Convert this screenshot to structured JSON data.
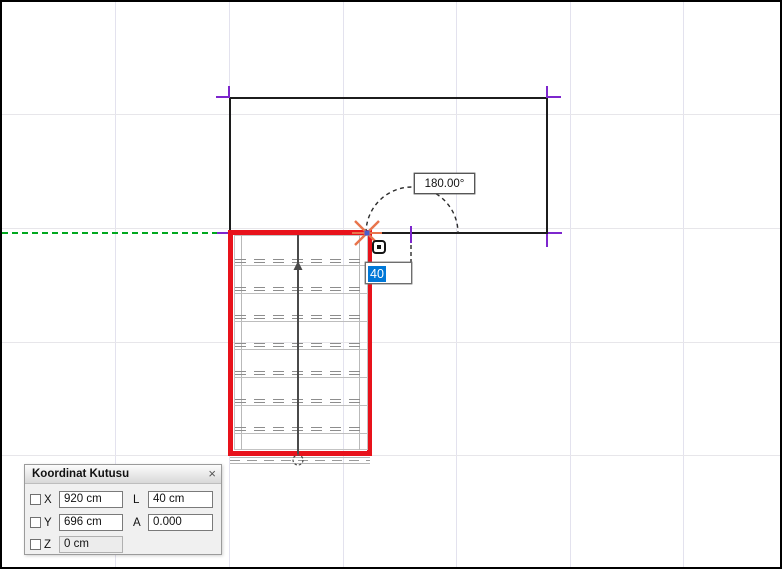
{
  "drawing": {
    "angle_readout": "180.00°",
    "length_input_value": "40",
    "colors": {
      "selection_blue": "#0078d7",
      "stair_highlight_red": "#e8121b",
      "guide_green": "#00a81e",
      "marker_purple": "#7d26cd",
      "cursor_orange": "#e8744b",
      "line_black": "#1c1c1c"
    }
  },
  "coordinate_panel": {
    "title": "Koordinat Kutusu",
    "close_label": "×",
    "rows": [
      {
        "axis": "X",
        "value": "920 cm",
        "label2": "L",
        "value2": "40 cm"
      },
      {
        "axis": "Y",
        "value": "696 cm",
        "label2": "A",
        "value2": "0.000"
      },
      {
        "axis": "Z",
        "value": "0 cm"
      }
    ]
  }
}
